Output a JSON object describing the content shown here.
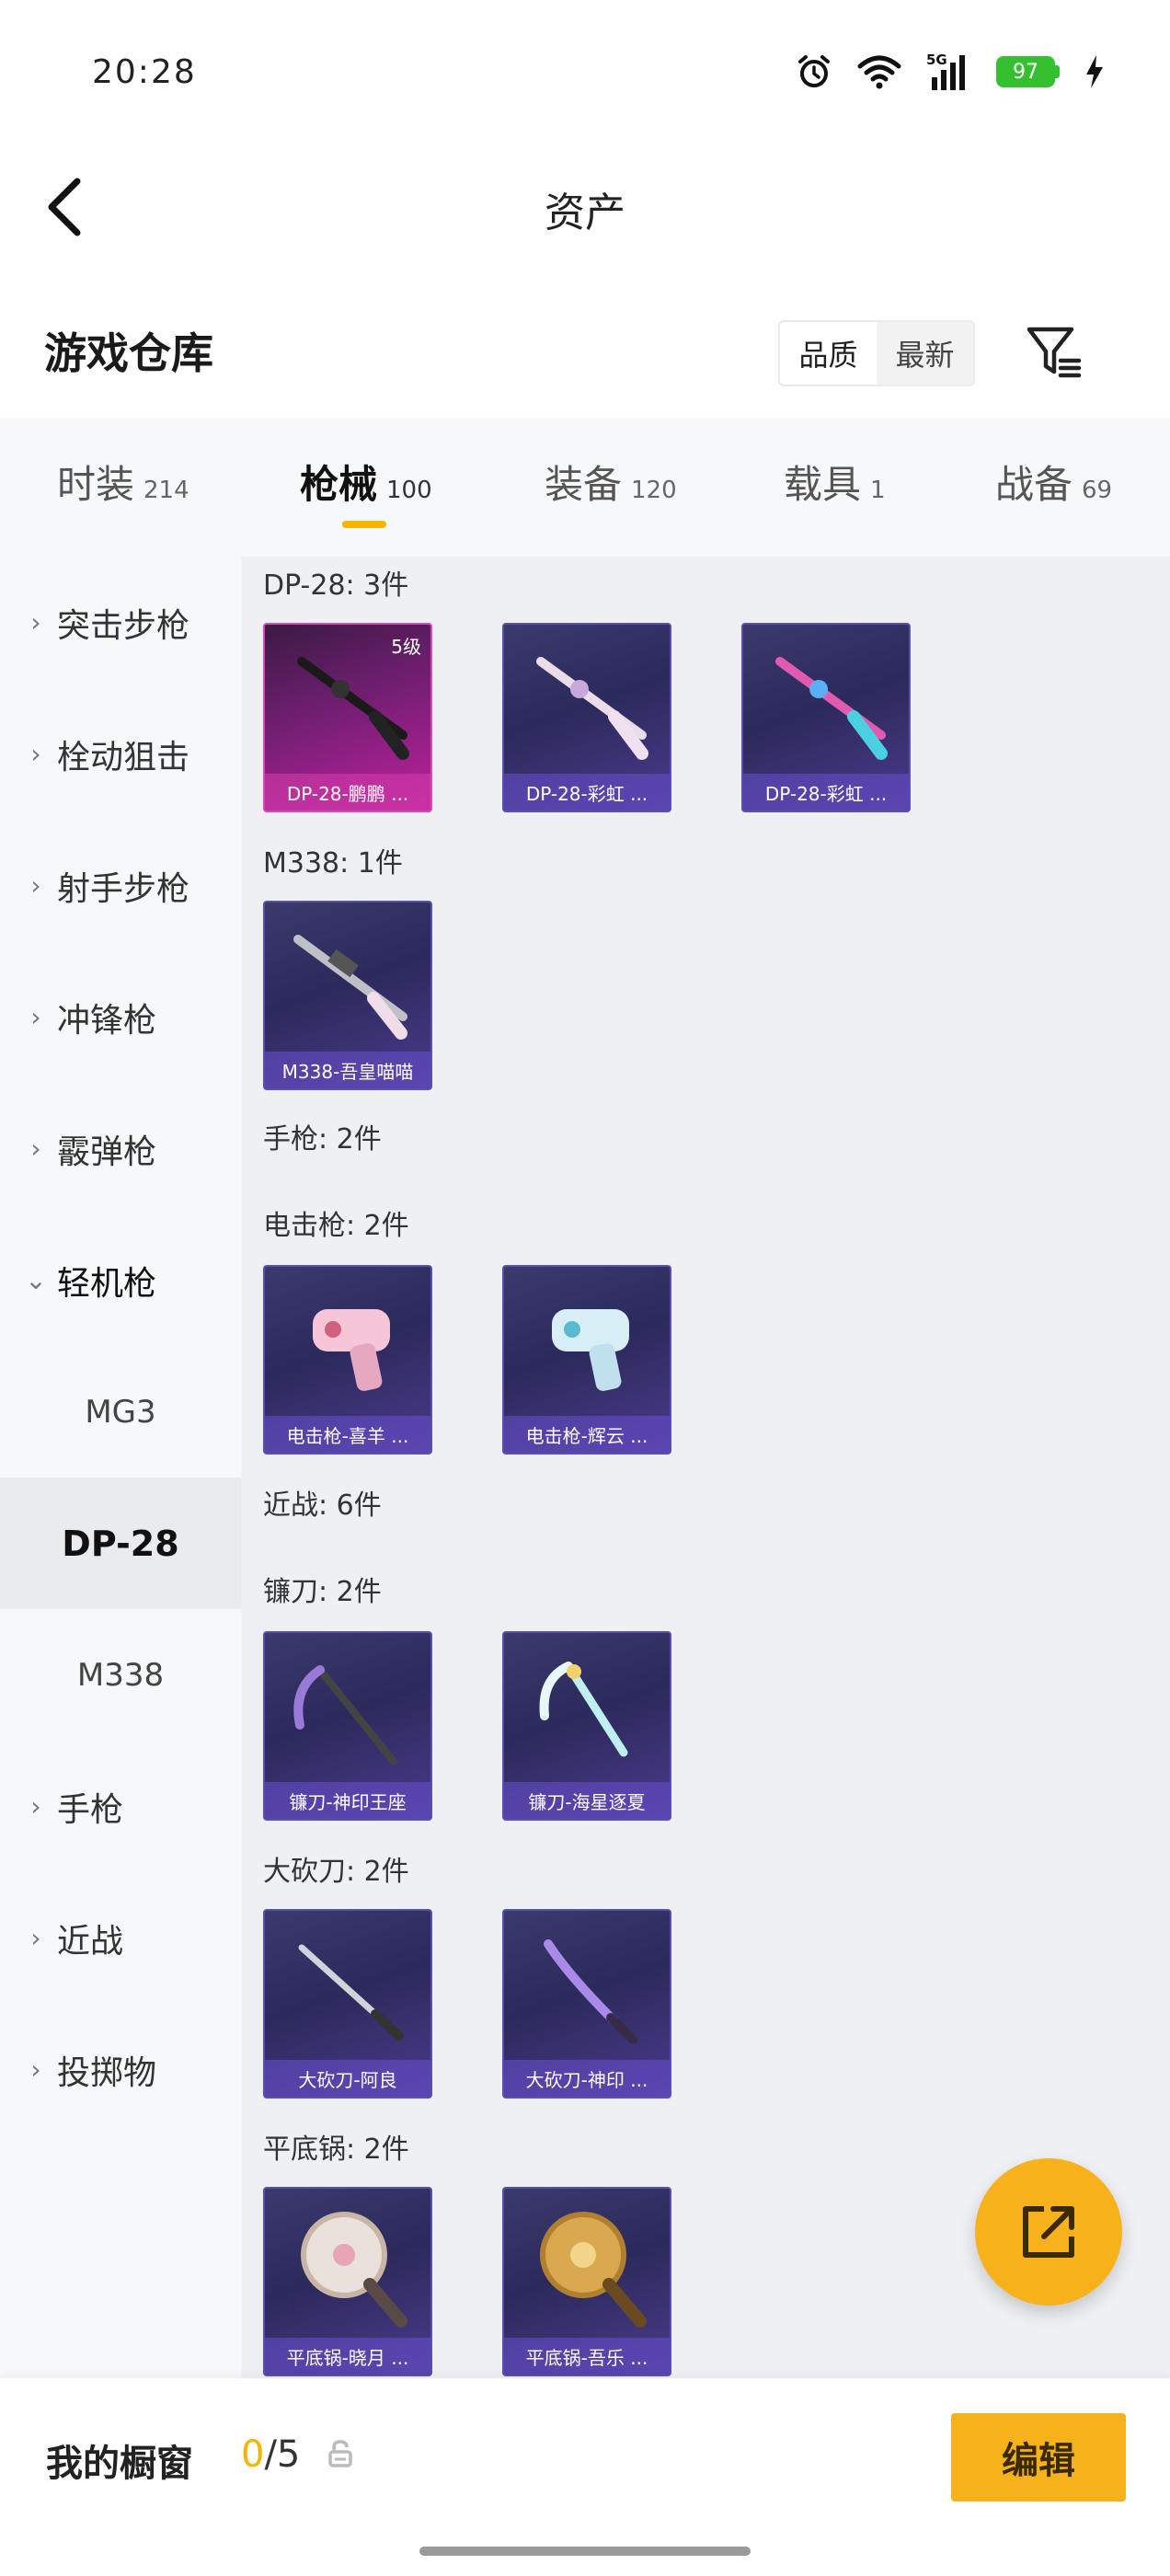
{
  "status": {
    "time": "20:28",
    "battery": "97",
    "network": "5G",
    "icons": [
      "alarm-icon",
      "wifi-icon",
      "signal-icon",
      "battery-icon",
      "charging-icon"
    ]
  },
  "nav": {
    "title": "资产",
    "back_icon": "chevron-left-icon"
  },
  "warehouse": {
    "title": "游戏仓库",
    "sort_options": [
      "品质",
      "最新"
    ],
    "filter_icon": "filter-icon"
  },
  "category_tabs": [
    {
      "label": "时装",
      "count": "214"
    },
    {
      "label": "枪械",
      "count": "100"
    },
    {
      "label": "装备",
      "count": "120"
    },
    {
      "label": "载具",
      "count": "1"
    },
    {
      "label": "战备",
      "count": "69"
    }
  ],
  "active_tab": "枪械",
  "sidebar": {
    "items": [
      {
        "label": "突击步枪"
      },
      {
        "label": "栓动狙击"
      },
      {
        "label": "射手步枪"
      },
      {
        "label": "冲锋枪"
      },
      {
        "label": "霰弹枪"
      },
      {
        "label": "轻机枪"
      },
      {
        "label": "MG3"
      },
      {
        "label": "DP-28"
      },
      {
        "label": "M338"
      },
      {
        "label": "手枪"
      },
      {
        "label": "近战"
      },
      {
        "label": "投掷物"
      }
    ]
  },
  "content": {
    "groups": [
      {
        "label": "DP-28: 3件"
      },
      {
        "label": "M338: 1件"
      },
      {
        "label": "手枪: 2件"
      },
      {
        "label": "电击枪: 2件"
      },
      {
        "label": "近战: 6件"
      },
      {
        "label": "镰刀: 2件"
      },
      {
        "label": "大砍刀: 2件"
      },
      {
        "label": "平底锅: 2件"
      }
    ],
    "cards": [
      {
        "label": "DP-28-鹏鹏 ...",
        "badge": "5级"
      },
      {
        "label": "DP-28-彩虹 ..."
      },
      {
        "label": "DP-28-彩虹 ..."
      },
      {
        "label": "M338-吾皇喵喵"
      },
      {
        "label": "电击枪-喜羊 ..."
      },
      {
        "label": "电击枪-辉云 ..."
      },
      {
        "label": "镰刀-神印王座"
      },
      {
        "label": "镰刀-海星逐夏"
      },
      {
        "label": "大砍刀-阿良"
      },
      {
        "label": "大砍刀-神印 ..."
      },
      {
        "label": "平底锅-晓月 ..."
      },
      {
        "label": "平底锅-吾乐 ..."
      }
    ]
  },
  "showcase": {
    "label": "我的橱窗",
    "current": "0",
    "total": "/5"
  },
  "edit_button": "编辑",
  "colors": {
    "accent": "#f7b21b",
    "indicator": "#f4b400",
    "card_bg": "#3b3a6d",
    "card_pink": "#c0209c"
  }
}
